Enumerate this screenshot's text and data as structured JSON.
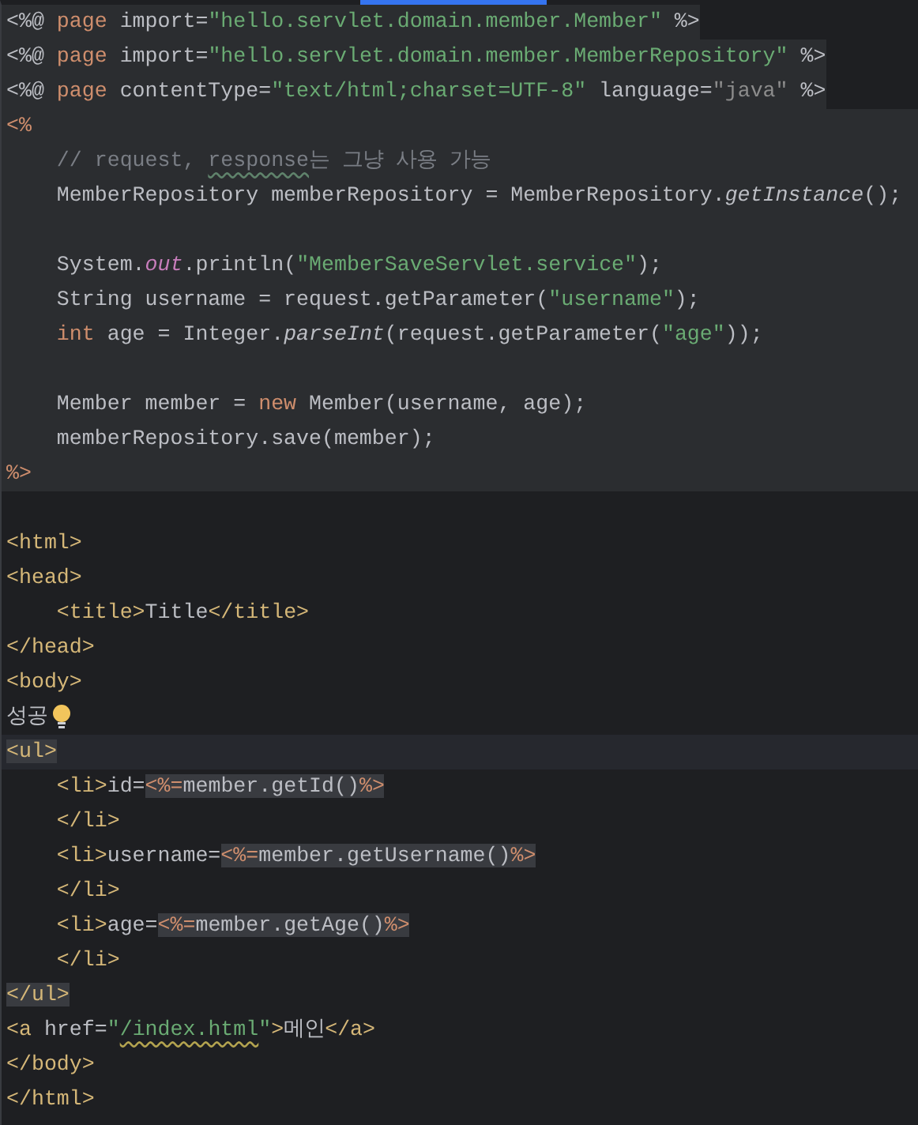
{
  "editor": {
    "active_tab_indicator": true,
    "lines": [
      {
        "kind": "directive",
        "tokens": [
          {
            "kind": "plain",
            "text": "<%@ "
          },
          {
            "kind": "keyword",
            "text": "page"
          },
          {
            "kind": "plain",
            "text": " import="
          },
          {
            "kind": "string",
            "text": "\"hello.servlet.domain.member.Member\""
          },
          {
            "kind": "plain",
            "text": " %>"
          }
        ]
      },
      {
        "kind": "directive",
        "tokens": [
          {
            "kind": "plain",
            "text": "<%@ "
          },
          {
            "kind": "keyword",
            "text": "page"
          },
          {
            "kind": "plain",
            "text": " import="
          },
          {
            "kind": "string",
            "text": "\"hello.servlet.domain.member.MemberRepository\""
          },
          {
            "kind": "plain",
            "text": " %>"
          }
        ]
      },
      {
        "kind": "directive",
        "tokens": [
          {
            "kind": "plain",
            "text": "<%@ "
          },
          {
            "kind": "keyword",
            "text": "page"
          },
          {
            "kind": "plain",
            "text": " contentType="
          },
          {
            "kind": "string",
            "text": "\"text/html;charset=UTF-8\""
          },
          {
            "kind": "plain",
            "text": " language="
          },
          {
            "kind": "dim",
            "text": "\"java\""
          },
          {
            "kind": "plain",
            "text": " %>"
          }
        ]
      },
      {
        "kind": "scriptlet",
        "tokens": [
          {
            "kind": "delim",
            "text": "<%"
          }
        ]
      },
      {
        "kind": "scriptlet",
        "tokens": [
          {
            "kind": "comment",
            "text": "    // request, "
          },
          {
            "kind": "comment",
            "text": "response",
            "typo": true
          },
          {
            "kind": "comment",
            "text": "는 그냥 사용 가능"
          }
        ]
      },
      {
        "kind": "scriptlet",
        "tokens": [
          {
            "kind": "plain",
            "text": "    MemberRepository memberRepository = MemberRepository."
          },
          {
            "kind": "italic",
            "text": "getInstance"
          },
          {
            "kind": "plain",
            "text": "();"
          }
        ]
      },
      {
        "kind": "scriptlet"
      },
      {
        "kind": "scriptlet",
        "tokens": [
          {
            "kind": "plain",
            "text": "    System."
          },
          {
            "kind": "static",
            "text": "out"
          },
          {
            "kind": "plain",
            "text": ".println("
          },
          {
            "kind": "string",
            "text": "\"MemberSaveServlet.service\""
          },
          {
            "kind": "plain",
            "text": ");"
          }
        ]
      },
      {
        "kind": "scriptlet",
        "tokens": [
          {
            "kind": "plain",
            "text": "    String username = request.getParameter("
          },
          {
            "kind": "string",
            "text": "\"username\""
          },
          {
            "kind": "plain",
            "text": ");"
          }
        ]
      },
      {
        "kind": "scriptlet",
        "tokens": [
          {
            "kind": "keyword",
            "text": "    int"
          },
          {
            "kind": "plain",
            "text": " age = Integer."
          },
          {
            "kind": "italic",
            "text": "parseInt"
          },
          {
            "kind": "plain",
            "text": "(request.getParameter("
          },
          {
            "kind": "string",
            "text": "\"age\""
          },
          {
            "kind": "plain",
            "text": "));"
          }
        ]
      },
      {
        "kind": "scriptlet"
      },
      {
        "kind": "scriptlet",
        "tokens": [
          {
            "kind": "plain",
            "text": "    Member member = "
          },
          {
            "kind": "keyword",
            "text": "new"
          },
          {
            "kind": "plain",
            "text": " Member(username, age);"
          }
        ]
      },
      {
        "kind": "scriptlet",
        "tokens": [
          {
            "kind": "plain",
            "text": "    memberRepository.save(member);"
          }
        ]
      },
      {
        "kind": "scriptlet",
        "tokens": [
          {
            "kind": "delim",
            "text": "%>"
          }
        ]
      },
      {
        "kind": "markup"
      },
      {
        "kind": "markup",
        "tokens": [
          {
            "kind": "tag",
            "text": "<html>"
          }
        ]
      },
      {
        "kind": "markup",
        "tokens": [
          {
            "kind": "tag",
            "text": "<head>"
          }
        ]
      },
      {
        "kind": "markup",
        "tokens": [
          {
            "kind": "tag",
            "text": "    <title>"
          },
          {
            "kind": "plain",
            "text": "Title"
          },
          {
            "kind": "tag",
            "text": "</title>"
          }
        ]
      },
      {
        "kind": "markup",
        "tokens": [
          {
            "kind": "tag",
            "text": "</head>"
          }
        ]
      },
      {
        "kind": "markup",
        "tokens": [
          {
            "kind": "tag",
            "text": "<body>"
          }
        ]
      },
      {
        "kind": "markup",
        "bulb": true,
        "tokens": [
          {
            "kind": "plain",
            "text": "성공"
          }
        ]
      },
      {
        "kind": "markup",
        "current": true,
        "tokens": [
          {
            "kind": "tag",
            "text": "<ul>",
            "boxed": true
          }
        ]
      },
      {
        "kind": "markup",
        "tokens": [
          {
            "kind": "tag",
            "text": "    <li>"
          },
          {
            "kind": "plain",
            "text": "id="
          },
          {
            "kind": "delim",
            "text": "<%=",
            "boxed": true
          },
          {
            "kind": "plain",
            "text": "member.getId()",
            "boxed": true
          },
          {
            "kind": "delim",
            "text": "%>",
            "boxed": true
          }
        ]
      },
      {
        "kind": "markup",
        "tokens": [
          {
            "kind": "tag",
            "text": "    </li>"
          }
        ]
      },
      {
        "kind": "markup",
        "tokens": [
          {
            "kind": "tag",
            "text": "    <li>"
          },
          {
            "kind": "plain",
            "text": "username="
          },
          {
            "kind": "delim",
            "text": "<%=",
            "boxed": true
          },
          {
            "kind": "plain",
            "text": "member.getUsername()",
            "boxed": true
          },
          {
            "kind": "delim",
            "text": "%>",
            "boxed": true
          }
        ]
      },
      {
        "kind": "markup",
        "tokens": [
          {
            "kind": "tag",
            "text": "    </li>"
          }
        ]
      },
      {
        "kind": "markup",
        "tokens": [
          {
            "kind": "tag",
            "text": "    <li>"
          },
          {
            "kind": "plain",
            "text": "age="
          },
          {
            "kind": "delim",
            "text": "<%=",
            "boxed": true
          },
          {
            "kind": "plain",
            "text": "member.getAge()",
            "boxed": true
          },
          {
            "kind": "delim",
            "text": "%>",
            "boxed": true
          }
        ]
      },
      {
        "kind": "markup",
        "tokens": [
          {
            "kind": "tag",
            "text": "    </li>"
          }
        ]
      },
      {
        "kind": "markup",
        "tokens": [
          {
            "kind": "tag",
            "text": "</ul>",
            "boxed": true
          }
        ]
      },
      {
        "kind": "markup",
        "tokens": [
          {
            "kind": "tag",
            "text": "<a "
          },
          {
            "kind": "plain",
            "text": "href="
          },
          {
            "kind": "string",
            "text": "\""
          },
          {
            "kind": "string",
            "text": "/index.html",
            "typo": true
          },
          {
            "kind": "string",
            "text": "\""
          },
          {
            "kind": "tag",
            "text": ">"
          },
          {
            "kind": "plain",
            "text": "메인"
          },
          {
            "kind": "tag",
            "text": "</a>"
          }
        ]
      },
      {
        "kind": "markup",
        "tokens": [
          {
            "kind": "tag",
            "text": "</body>"
          }
        ]
      },
      {
        "kind": "markup",
        "tokens": [
          {
            "kind": "tag",
            "text": "</html>"
          }
        ]
      }
    ]
  }
}
